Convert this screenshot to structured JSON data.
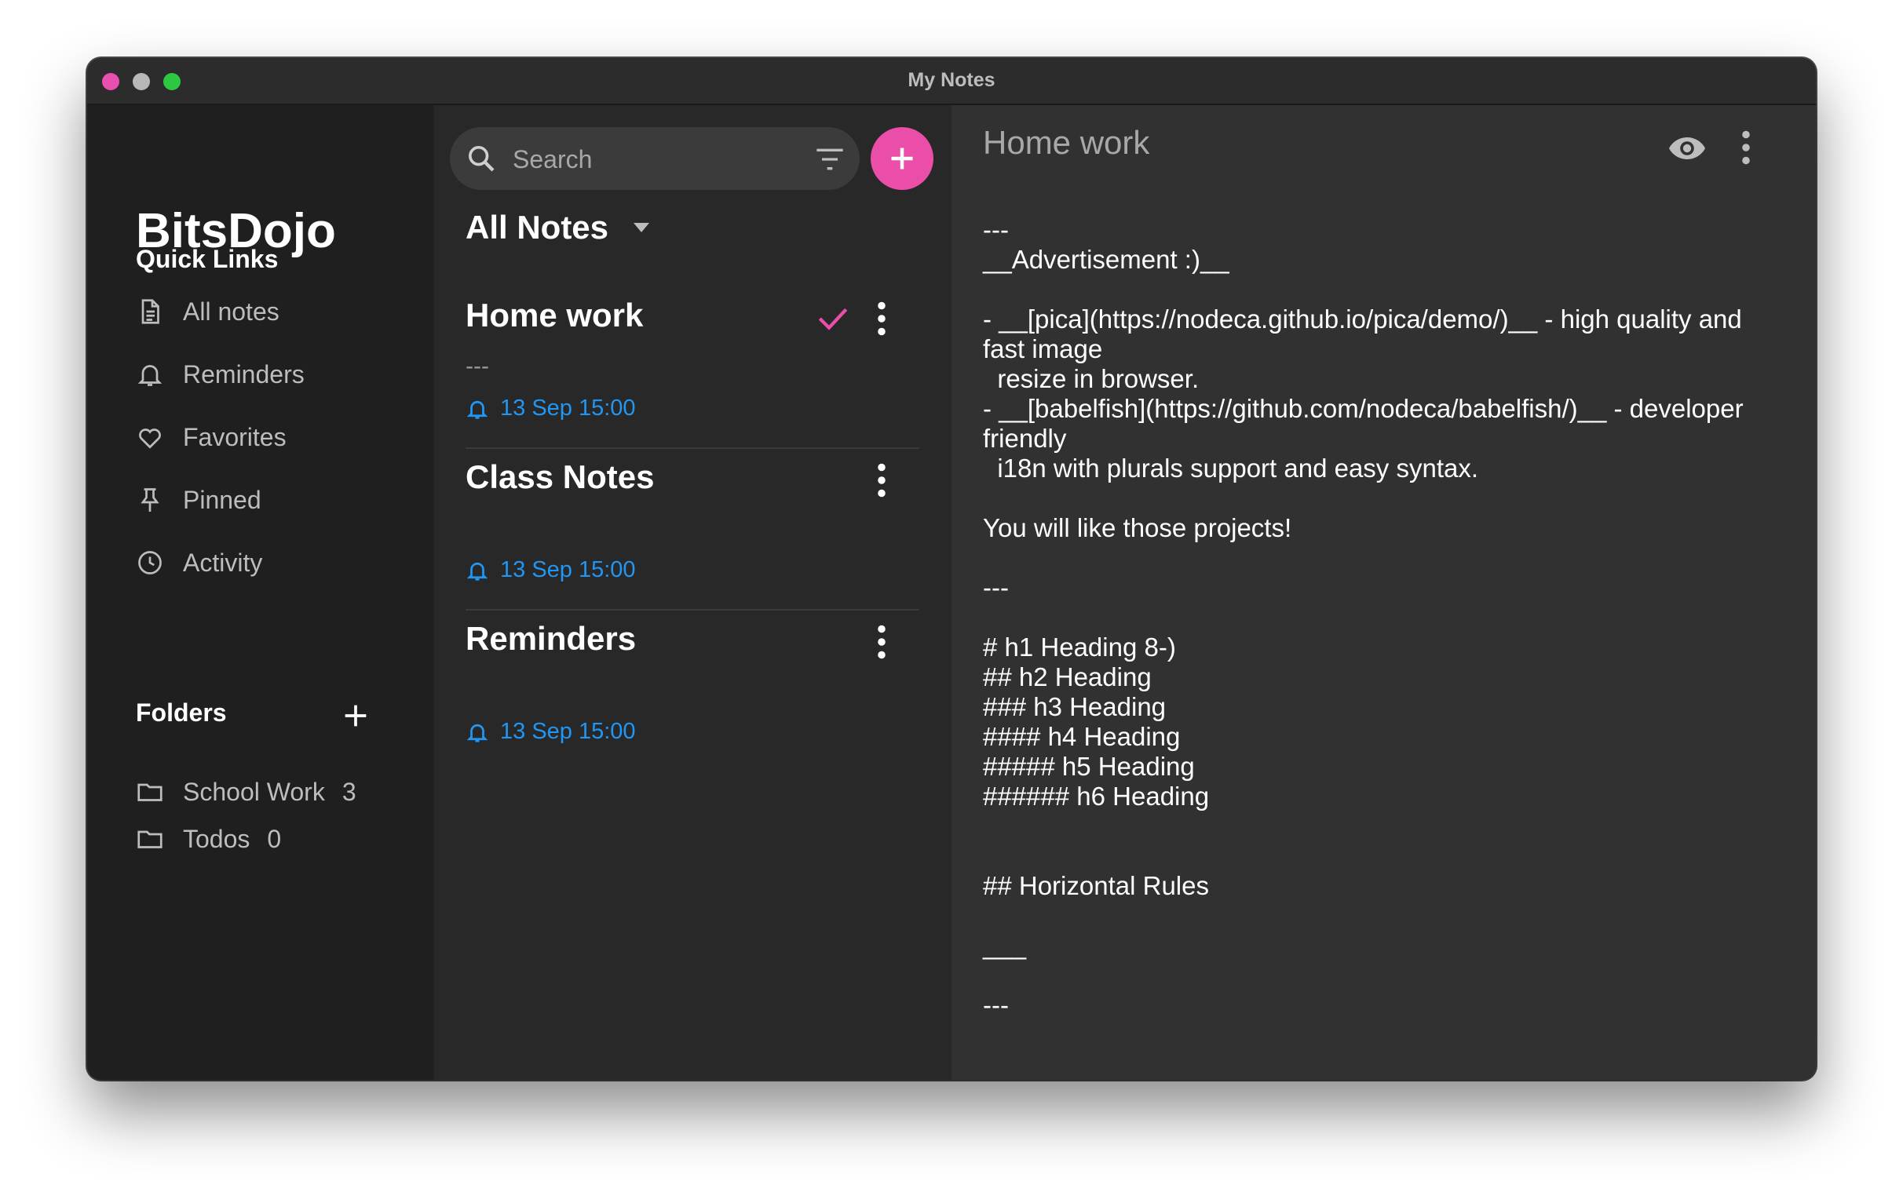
{
  "window": {
    "title": "My Notes",
    "controls": [
      "close",
      "minimize",
      "maximize"
    ]
  },
  "sidebar": {
    "brand": "BitsDojo",
    "quick_links_title": "Quick Links",
    "items": [
      {
        "label": "All notes",
        "icon": "document-icon"
      },
      {
        "label": "Reminders",
        "icon": "bell-icon"
      },
      {
        "label": "Favorites",
        "icon": "heart-icon"
      },
      {
        "label": "Pinned",
        "icon": "pin-icon"
      },
      {
        "label": "Activity",
        "icon": "clock-icon"
      }
    ],
    "folders_title": "Folders",
    "folders": [
      {
        "label": "School Work",
        "count": "3",
        "icon": "folder-icon"
      },
      {
        "label": "Todos",
        "count": "0",
        "icon": "folder-icon"
      }
    ]
  },
  "list": {
    "search_placeholder": "Search",
    "header": "All Notes",
    "notes": [
      {
        "title": "Home work",
        "preview": "---",
        "reminder": "13 Sep 15:00",
        "checked": true
      },
      {
        "title": "Class Notes",
        "preview": "",
        "reminder": "13 Sep 15:00",
        "checked": false
      },
      {
        "title": "Reminders",
        "preview": "",
        "reminder": "13 Sep 15:00",
        "checked": false
      }
    ]
  },
  "editor": {
    "title": "Home work",
    "content": "---\n__Advertisement :)__\n\n- __[pica](https://nodeca.github.io/pica/demo/)__ - high quality and fast image\n  resize in browser.\n- __[babelfish](https://github.com/nodeca/babelfish/)__ - developer friendly\n  i18n with plurals support and easy syntax.\n\nYou will like those projects!\n\n---\n\n# h1 Heading 8-)\n## h2 Heading\n### h3 Heading\n#### h4 Heading\n##### h5 Heading\n###### h6 Heading\n\n\n## Horizontal Rules\n\n___\n\n---"
  },
  "colors": {
    "accent": "#ea4ea9",
    "reminder": "#2196f3",
    "sidebar_bg": "#1f1f1f",
    "list_bg": "#282828",
    "editor_bg": "#313131"
  }
}
